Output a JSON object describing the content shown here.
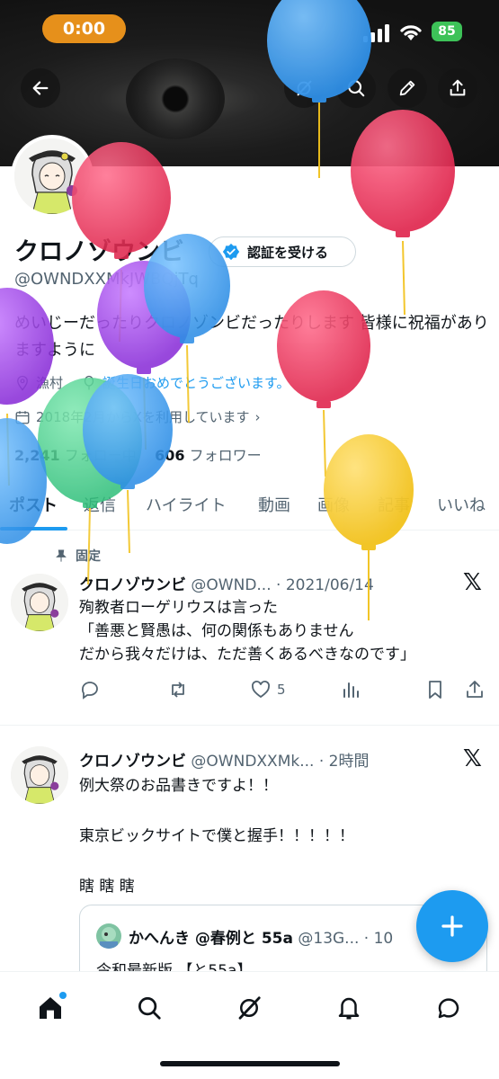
{
  "status_bar": {
    "time": "0:00",
    "battery": "85"
  },
  "header": {
    "back_icon": "arrow-left-icon",
    "actions": [
      "grok-icon",
      "search-icon",
      "edit-icon",
      "share-icon"
    ]
  },
  "profile": {
    "name": "クロノゾウンビ",
    "handle": "@OWNDXXMkJWBQjTq",
    "verify_button": "認証を受ける",
    "bio": "めいじーだったりクロノゾンビだったりします 皆様に祝福がありますように",
    "location": "漁村",
    "birthday_link": "誕生日おめでとうございます。",
    "joined": "2018年2月からXを利用しています",
    "following_count": "2,241",
    "following_label": "フォロー中",
    "followers_count": "606",
    "followers_label": "フォロワー"
  },
  "tabs": [
    "ポスト",
    "返信",
    "ハイライト",
    "動画",
    "画像",
    "記事",
    "いいね"
  ],
  "pinned_label": "固定",
  "tweets": [
    {
      "name": "クロノゾウンビ",
      "handle_time": "@OWND... · 2021/06/14",
      "lines": [
        "殉教者ローゲリウスは言った",
        "「善悪と賢愚は、何の関係もありません",
        "だから我々だけは、ただ善くあるべきなのです」"
      ],
      "likes": "5"
    },
    {
      "name": "クロノゾウンビ",
      "handle_time": "@OWNDXXMk... · 2時間",
      "lines": [
        "例大祭のお品書きですよ！！",
        "",
        "東京ビックサイトで僕と握手！！！！！",
        "",
        "瞎 瞎 瞎"
      ],
      "quote": {
        "name": "かへんき @春例と 55a",
        "handle": "@13G... · 10",
        "text": "令和最新版 【と55a】"
      }
    }
  ],
  "fab": "compose-plus-icon",
  "bottom_nav": [
    "home-icon",
    "search-icon",
    "grok-icon",
    "bell-icon",
    "messages-icon"
  ],
  "colors": {
    "accent": "#1d9bf0",
    "clock_pill": "#e6901b",
    "battery": "#3dc258"
  }
}
